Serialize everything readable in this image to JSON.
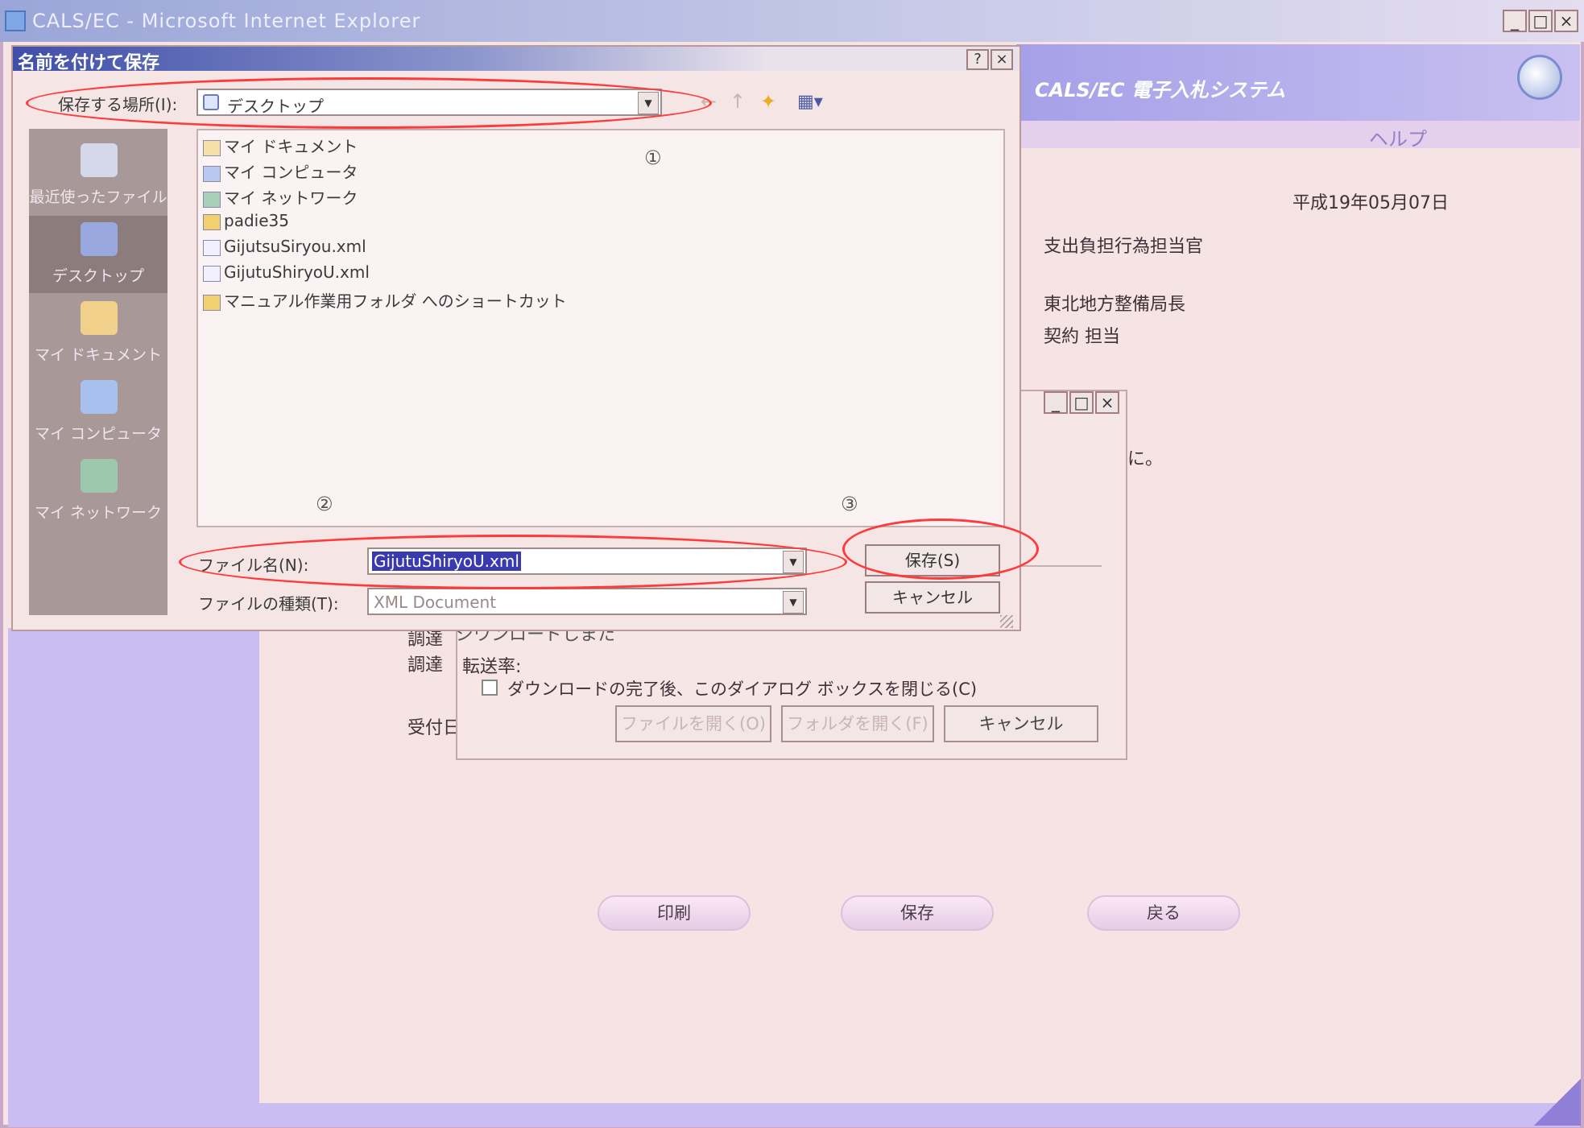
{
  "ie_window": {
    "title": "CALS/EC - Microsoft Internet Explorer",
    "controls": [
      "_",
      "□",
      "×"
    ]
  },
  "page": {
    "system_title": "CALS/EC 電子入札システム",
    "help_label": "ヘルプ",
    "date": "平成19年05月07日",
    "recipient_lines": [
      "支出負担行為担当官",
      "東北地方整備局長",
      "契約 担当"
    ],
    "partial_text": "に。",
    "partial_labels": [
      "調達",
      "調達",
      "受付日"
    ],
    "buttons": {
      "print": "印刷",
      "save": "保存",
      "back": "戻る"
    }
  },
  "download_dialog": {
    "controls": [
      "_",
      "□",
      "×"
    ],
    "partial_status": "ジウンロードしまた",
    "transfer_rate_label": "転送率:",
    "close_checkbox_label": "ダウンロードの完了後、このダイアログ ボックスを閉じる(C)",
    "buttons": {
      "open_file": "ファイルを開く(O)",
      "open_folder": "フォルダを開く(F)",
      "cancel": "キャンセル"
    }
  },
  "save_dialog": {
    "title": "名前を付けて保存",
    "title_controls": [
      "?",
      "×"
    ],
    "save_in_label": "保存する場所(I):",
    "save_in_value": "デスクトップ",
    "places": [
      {
        "label": "最近使ったファイル"
      },
      {
        "label": "デスクトップ"
      },
      {
        "label": "マイ ドキュメント"
      },
      {
        "label": "マイ コンピュータ"
      },
      {
        "label": "マイ ネットワーク"
      }
    ],
    "files": [
      "マイ ドキュメント",
      "マイ コンピュータ",
      "マイ ネットワーク",
      "padie35",
      "GijutsuSiryou.xml",
      "GijutuShiryoU.xml",
      "マニュアル作業用フォルダ へのショートカット"
    ],
    "filename_label": "ファイル名(N):",
    "filename_value": "GijutuShiryoU.xml",
    "filetype_label": "ファイルの種類(T):",
    "filetype_value": "XML Document",
    "save_button": "保存(S)",
    "cancel_button": "キャンセル"
  },
  "annotations": {
    "marks": [
      "①",
      "②",
      "③"
    ],
    "color": "#ff3a3a"
  }
}
